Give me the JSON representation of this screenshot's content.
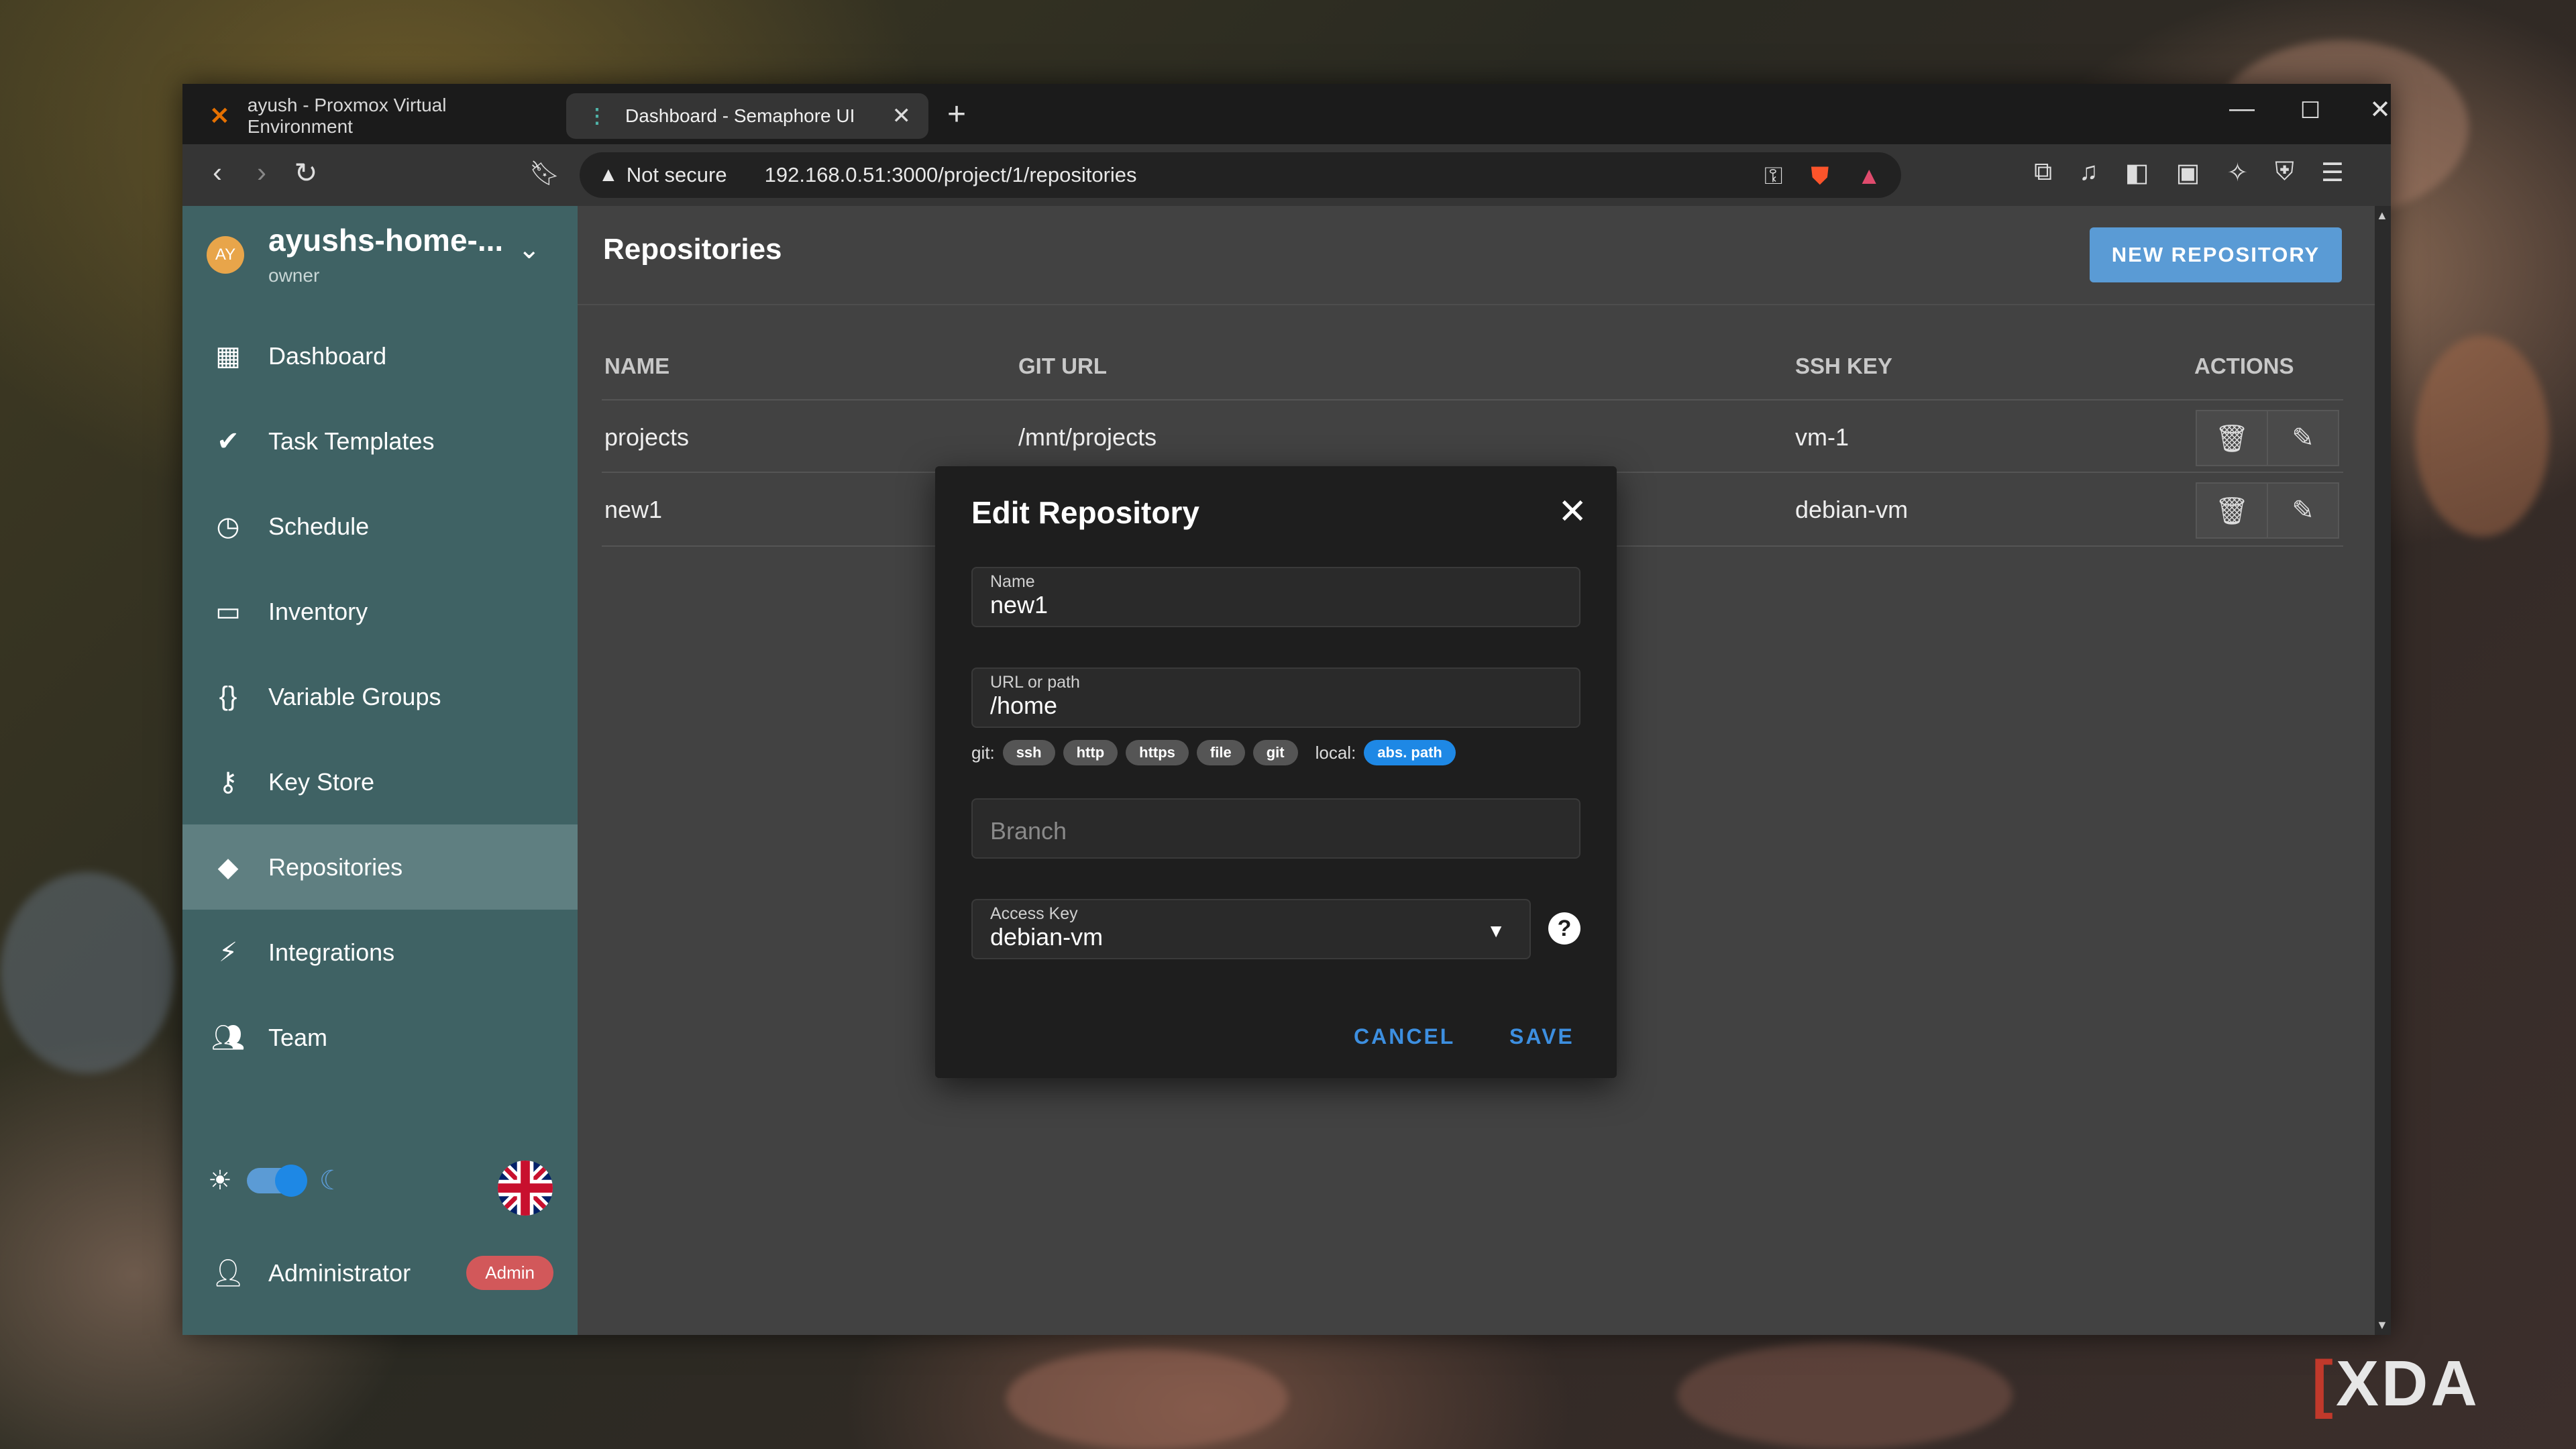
{
  "browser": {
    "tabs": [
      {
        "label": "ayush - Proxmox Virtual Environment",
        "icon": "proxmox-icon",
        "active": false
      },
      {
        "label": "Dashboard - Semaphore UI",
        "icon": "semaphore-icon",
        "active": true
      }
    ],
    "not_secure": "Not secure",
    "url": "192.168.0.51:3000/project/1/repositories"
  },
  "sidebar": {
    "project_name": "ayushs-home-...",
    "role": "owner",
    "avatar_initials": "AY",
    "items": [
      {
        "label": "Dashboard",
        "icon": "dashboard-icon"
      },
      {
        "label": "Task Templates",
        "icon": "double-check-icon"
      },
      {
        "label": "Schedule",
        "icon": "clock-icon"
      },
      {
        "label": "Inventory",
        "icon": "monitor-icon"
      },
      {
        "label": "Variable Groups",
        "icon": "braces-icon"
      },
      {
        "label": "Key Store",
        "icon": "key-icon"
      },
      {
        "label": "Repositories",
        "icon": "git-icon",
        "active": true
      },
      {
        "label": "Integrations",
        "icon": "plug-icon"
      },
      {
        "label": "Team",
        "icon": "team-icon"
      }
    ],
    "user": {
      "name": "Administrator",
      "badge": "Admin"
    }
  },
  "main": {
    "title": "Repositories",
    "new_button": "NEW REPOSITORY",
    "columns": [
      "NAME",
      "GIT URL",
      "SSH KEY",
      "ACTIONS"
    ],
    "rows": [
      {
        "name": "projects",
        "git_url": "/mnt/projects",
        "ssh_key": "vm-1"
      },
      {
        "name": "new1",
        "git_url": "",
        "ssh_key": "debian-vm"
      }
    ]
  },
  "dialog": {
    "title": "Edit Repository",
    "name_label": "Name",
    "name_value": "new1",
    "url_label": "URL or path",
    "url_value": "/home",
    "git_prefix": "git:",
    "git_chips": [
      "ssh",
      "http",
      "https",
      "file",
      "git"
    ],
    "local_prefix": "local:",
    "local_chip": "abs. path",
    "branch_placeholder": "Branch",
    "access_key_label": "Access Key",
    "access_key_value": "debian-vm",
    "help": "?",
    "cancel": "CANCEL",
    "save": "SAVE"
  },
  "watermark": "XDA",
  "colors": {
    "sidebar": "#3f6264",
    "sidebar_active": "#5f7f81",
    "content": "#424242",
    "primary": "#5a9bd5",
    "accent_blue": "#1e88e5",
    "admin_badge": "#d2585a"
  }
}
